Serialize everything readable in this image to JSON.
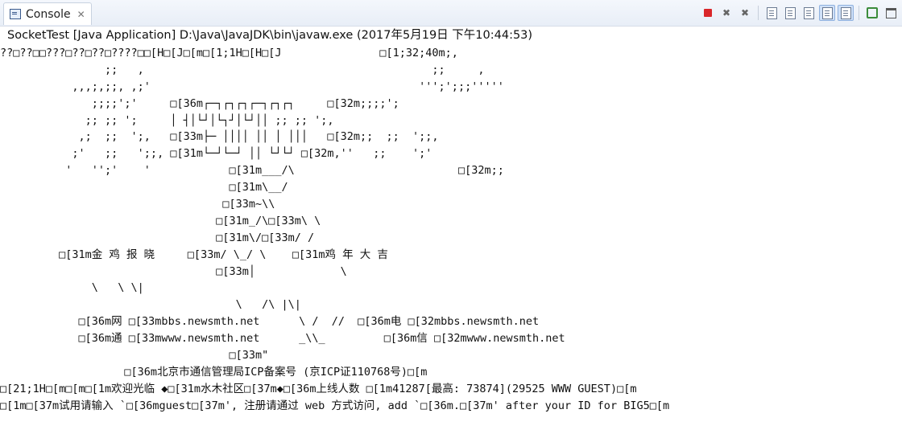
{
  "view": {
    "tab_label": "Console",
    "tab_close": "✕",
    "toolbar": [
      {
        "name": "terminate-button",
        "glyph": ""
      },
      {
        "name": "remove-launch-button",
        "glyph": "✖"
      },
      {
        "name": "remove-all-terminated-button",
        "glyph": "✖"
      },
      {
        "name": "clear-console-button",
        "glyph": ""
      },
      {
        "name": "scroll-lock-button",
        "glyph": ""
      },
      {
        "name": "word-wrap-button",
        "glyph": ""
      },
      {
        "name": "show-console-on-stdout-button",
        "glyph": ""
      },
      {
        "name": "show-console-on-stderr-button",
        "glyph": ""
      },
      {
        "name": "pin-console-button",
        "glyph": ""
      },
      {
        "name": "maximize-button",
        "glyph": ""
      }
    ]
  },
  "launch_label": "SocketTest [Java Application] D:\\Java\\JavaJDK\\bin\\javaw.exe (2017年5月19日 下午10:44:53)",
  "console_lines": [
    "??□??□□???□??□??□????□□[H□[J□[m□[1;1H□[H□[J               □[1;32;40m;,",
    "                ;;   ,                                            ;;     ,",
    "           ,,,;,;;, ,;'                                         ''';';;;'''''",
    "              ;;;;';'     □[36m┌─┐┌┐┌┐┌─┐┌┐┌┐     □[32m;;;;';",
    "             ;; ;; ';     │ ┤│└┘│└┐┘│└┘││ ;; ;; ';,",
    "            ,;  ;;  ';,   □[33m├─ ││││ ││ │ │││   □[32m;;  ;;  ';;,",
    "           ;'   ;;   ';;, □[31m└─┘└─┘ ││ └┘└┘ □[32m,''   ;;    ';'",
    "          '   '';'    '            □[31m___/\\                         □[32m;;",
    "                                   □[31m\\__/",
    "                                  □[33m~\\\\",
    "                                 □[31m_/\\□[33m\\ \\",
    "                                 □[31m\\/□[33m/ /",
    "         □[31m金 鸡 报 晓     □[33m/ \\_/ \\    □[31m鸡 年 大 吉",
    "                                 □[33m│             \\",
    "              \\   \\ \\|",
    "                                    \\   /\\ |\\|",
    "            □[36m网 □[33mbbs.newsmth.net      \\ /  //  □[36m电 □[32mbbs.newsmth.net",
    "            □[36m通 □[33mwww.newsmth.net      _\\\\_         □[36m信 □[32mwww.newsmth.net",
    "                                   □[33m\"",
    "                   □[36m北京市通信管理局ICP备案号 (京ICP证110768号)□[m",
    "□[21;1H□[m□[m□[1m欢迎光临 ◆□[31m水木社区□[37m◆□[36m上线人数 □[1m41287[最高: 73874](29525 WWW GUEST)□[m",
    "□[1m□[37m试用请输入 `□[36mguest□[37m', 注册请通过 web 方式访问, add `□[36m.□[37m' after your ID for BIG5□[m"
  ]
}
